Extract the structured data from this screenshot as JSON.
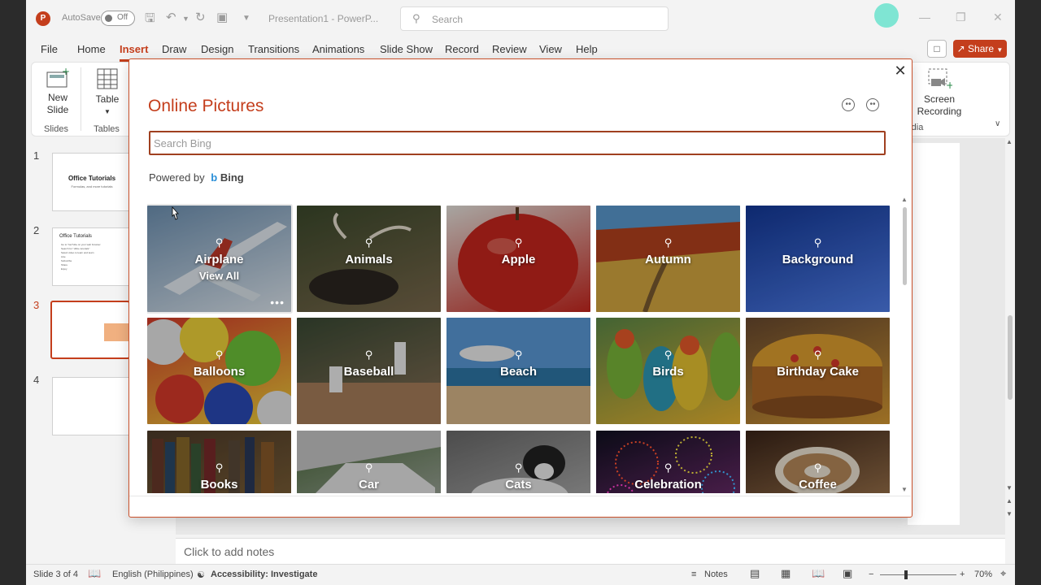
{
  "titlebar": {
    "logo": "P",
    "autosave_label": "AutoSave",
    "autosave_state": "Off",
    "doc_title": "Presentation1 - PowerP...",
    "search_placeholder": "Search",
    "icons": [
      "save-icon",
      "undo-icon",
      "redo-icon",
      "present-icon",
      "customize-icon"
    ]
  },
  "menu": {
    "items": [
      "File",
      "Home",
      "Insert",
      "Draw",
      "Design",
      "Transitions",
      "Animations",
      "Slide Show",
      "Record",
      "Review",
      "View",
      "Help"
    ],
    "active": "Insert",
    "share_label": "Share"
  },
  "ribbon": {
    "new_slide": "New Slide",
    "slides_group": "Slides",
    "table": "Table",
    "tables_group": "Tables",
    "screen_recording": "Screen Recording",
    "media_group_partial": "dia"
  },
  "slides": [
    {
      "num": "1",
      "title": "Office Tutorials",
      "subtitle": "Formulas, and more tutorials"
    },
    {
      "num": "2",
      "title": "Office Tutorials",
      "lines": [
        "Go to YouTube on your web browser",
        "Search for \"office tutorials\"",
        "Select video to learn and learn",
        "Like",
        "Subscribe",
        "Share",
        "Enjoy"
      ]
    },
    {
      "num": "3"
    },
    {
      "num": "4"
    }
  ],
  "active_slide": "3",
  "notes": {
    "placeholder": "Click to add notes"
  },
  "status": {
    "slide_of": "Slide 3 of 4",
    "language": "English (Philippines)",
    "accessibility": "Accessibility: Investigate",
    "notes_label": "Notes",
    "zoom": "70%"
  },
  "dialog": {
    "title": "Online Pictures",
    "search_placeholder": "Search Bing",
    "powered_by": "Powered by",
    "bing": "Bing",
    "view_all": "View All",
    "tiles": [
      {
        "label": "Airplane",
        "c1": "#6f93b5",
        "c2": "#dfe8f0"
      },
      {
        "label": "Animals",
        "c1": "#3c4a2c",
        "c2": "#7b6a4d"
      },
      {
        "label": "Apple",
        "c1": "#e9e6e0",
        "c2": "#c8261e"
      },
      {
        "label": "Autumn",
        "c1": "#c86a2a",
        "c2": "#d9b24c"
      },
      {
        "label": "Background",
        "c1": "#0f2c78",
        "c2": "#3e63b8"
      },
      {
        "label": "Balloons",
        "c1": "#d83a2a",
        "c2": "#f1d43a"
      },
      {
        "label": "Baseball",
        "c1": "#3a4a34",
        "c2": "#8a7258"
      },
      {
        "label": "Beach",
        "c1": "#3f82c6",
        "c2": "#d9b78a"
      },
      {
        "label": "Birds",
        "c1": "#5d8a48",
        "c2": "#e8b531"
      },
      {
        "label": "Birthday Cake",
        "c1": "#6a4a30",
        "c2": "#d79a33"
      },
      {
        "label": "Books",
        "c1": "#4d3b2a",
        "c2": "#8a6a3a"
      },
      {
        "label": "Car",
        "c1": "#4a6b3a",
        "c2": "#b7b7b7"
      },
      {
        "label": "Cats",
        "c1": "#6a6a6a",
        "c2": "#bdbdbd"
      },
      {
        "label": "Celebration",
        "c1": "#0d0d1a",
        "c2": "#6e2a6a"
      },
      {
        "label": "Coffee",
        "c1": "#3a2418",
        "c2": "#b88a5a"
      }
    ]
  }
}
